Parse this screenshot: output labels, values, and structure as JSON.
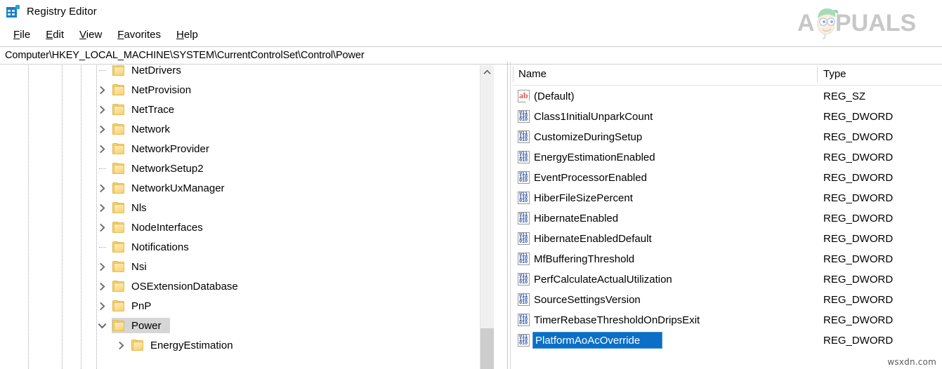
{
  "window": {
    "title": "Registry Editor",
    "icon": "registry-editor-icon"
  },
  "menubar": {
    "items": [
      {
        "label": "File",
        "accesskey": "F",
        "rest": "ile"
      },
      {
        "label": "Edit",
        "accesskey": "E",
        "rest": "dit"
      },
      {
        "label": "View",
        "accesskey": "V",
        "rest": "iew"
      },
      {
        "label": "Favorites",
        "accesskey": "F",
        "rest": "avorites"
      },
      {
        "label": "Help",
        "accesskey": "H",
        "rest": "elp"
      }
    ]
  },
  "address": {
    "path": "Computer\\HKEY_LOCAL_MACHINE\\SYSTEM\\CurrentControlSet\\Control\\Power"
  },
  "tree": {
    "items": [
      {
        "label": "NetDrivers",
        "indent": 0,
        "expander": "none",
        "selected": false
      },
      {
        "label": "NetProvision",
        "indent": 0,
        "expander": "collapsed",
        "selected": false
      },
      {
        "label": "NetTrace",
        "indent": 0,
        "expander": "collapsed",
        "selected": false
      },
      {
        "label": "Network",
        "indent": 0,
        "expander": "collapsed",
        "selected": false
      },
      {
        "label": "NetworkProvider",
        "indent": 0,
        "expander": "collapsed",
        "selected": false
      },
      {
        "label": "NetworkSetup2",
        "indent": 0,
        "expander": "none",
        "selected": false
      },
      {
        "label": "NetworkUxManager",
        "indent": 0,
        "expander": "collapsed",
        "selected": false
      },
      {
        "label": "Nls",
        "indent": 0,
        "expander": "collapsed",
        "selected": false
      },
      {
        "label": "NodeInterfaces",
        "indent": 0,
        "expander": "collapsed",
        "selected": false
      },
      {
        "label": "Notifications",
        "indent": 0,
        "expander": "none",
        "selected": false
      },
      {
        "label": "Nsi",
        "indent": 0,
        "expander": "collapsed",
        "selected": false
      },
      {
        "label": "OSExtensionDatabase",
        "indent": 0,
        "expander": "collapsed",
        "selected": false
      },
      {
        "label": "PnP",
        "indent": 0,
        "expander": "collapsed",
        "selected": false
      },
      {
        "label": "Power",
        "indent": 0,
        "expander": "expanded",
        "selected": true
      },
      {
        "label": "EnergyEstimation",
        "indent": 1,
        "expander": "collapsed",
        "selected": false
      }
    ],
    "scrollbar": {
      "up_arrow": "chevron-up-icon"
    }
  },
  "list": {
    "columns": {
      "name": "Name",
      "type": "Type"
    },
    "rows": [
      {
        "name": "(Default)",
        "type": "REG_SZ",
        "icon": "reg-sz-icon",
        "selected": false
      },
      {
        "name": "Class1InitialUnparkCount",
        "type": "REG_DWORD",
        "icon": "reg-dword-icon",
        "selected": false
      },
      {
        "name": "CustomizeDuringSetup",
        "type": "REG_DWORD",
        "icon": "reg-dword-icon",
        "selected": false
      },
      {
        "name": "EnergyEstimationEnabled",
        "type": "REG_DWORD",
        "icon": "reg-dword-icon",
        "selected": false
      },
      {
        "name": "EventProcessorEnabled",
        "type": "REG_DWORD",
        "icon": "reg-dword-icon",
        "selected": false
      },
      {
        "name": "HiberFileSizePercent",
        "type": "REG_DWORD",
        "icon": "reg-dword-icon",
        "selected": false
      },
      {
        "name": "HibernateEnabled",
        "type": "REG_DWORD",
        "icon": "reg-dword-icon",
        "selected": false
      },
      {
        "name": "HibernateEnabledDefault",
        "type": "REG_DWORD",
        "icon": "reg-dword-icon",
        "selected": false
      },
      {
        "name": "MfBufferingThreshold",
        "type": "REG_DWORD",
        "icon": "reg-dword-icon",
        "selected": false
      },
      {
        "name": "PerfCalculateActualUtilization",
        "type": "REG_DWORD",
        "icon": "reg-dword-icon",
        "selected": false
      },
      {
        "name": "SourceSettingsVersion",
        "type": "REG_DWORD",
        "icon": "reg-dword-icon",
        "selected": false
      },
      {
        "name": "TimerRebaseThresholdOnDripsExit",
        "type": "REG_DWORD",
        "icon": "reg-dword-icon",
        "selected": false
      },
      {
        "name": "PlatformAoAcOverride",
        "type": "REG_DWORD",
        "icon": "reg-dword-icon",
        "selected": true
      }
    ]
  },
  "watermarks": {
    "brand": "APPUALS",
    "site": "wsxdn.com"
  },
  "colors": {
    "selection_focused": "#0b6fc8",
    "selection_unfocused": "#d6d6d6",
    "folder": "#f8d775",
    "accent": "#1a7fc1"
  }
}
